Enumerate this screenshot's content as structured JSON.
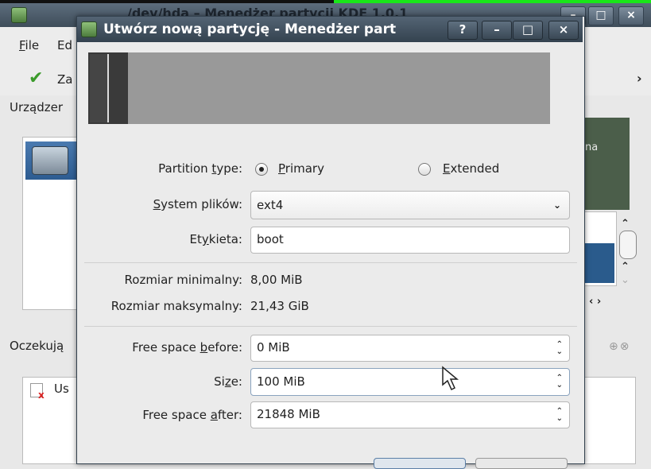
{
  "main_window": {
    "title": "/dev/hda – Menedżer partycji KDE 1.0.1",
    "menu": {
      "file": "File",
      "edit": "Ed"
    },
    "toolbar": {
      "apply_label": "Za",
      "more_arrow": "›"
    },
    "devices_title": "Urządzer",
    "partition_block_text": "na",
    "pending_title": "Oczekują",
    "pending_item": "Us",
    "pending_panel_buttons": "⊕⊗"
  },
  "dialog": {
    "title": "Utwórz nową partycję - Menedżer part",
    "buttons": {
      "help": "?",
      "minimize": "–",
      "maximize": "□",
      "close": "×"
    },
    "partition_type": {
      "label_pre": "Partition ",
      "label_u": "t",
      "label_post": "ype:",
      "primary": {
        "pre": "",
        "u": "P",
        "post": "rimary",
        "checked": true
      },
      "extended": {
        "pre": "",
        "u": "E",
        "post": "xtended",
        "checked": false
      }
    },
    "filesystem": {
      "label_pre": "",
      "label_u": "S",
      "label_post": "ystem plików:",
      "value": "ext4"
    },
    "label_field": {
      "label_pre": "Et",
      "label_u": "y",
      "label_post": "kieta:",
      "value": "boot"
    },
    "min_size": {
      "label": "Rozmiar minimalny:",
      "value": "8,00 MiB"
    },
    "max_size": {
      "label": "Rozmiar maksymalny:",
      "value": "21,43 GiB"
    },
    "free_before": {
      "label_pre": "Free space ",
      "label_u": "b",
      "label_post": "efore:",
      "value": "0 MiB"
    },
    "size": {
      "label_pre": "Si",
      "label_u": "z",
      "label_post": "e:",
      "value": "100 MiB"
    },
    "free_after": {
      "label_pre": "Free space ",
      "label_u": "a",
      "label_post": "fter:",
      "value": "21848 MiB"
    }
  },
  "colors": {
    "titlebar": "#3f4d5a",
    "partition_unallocated": "#999999",
    "partition_new": "#3a3a3a",
    "accent_green": "#19e619"
  }
}
